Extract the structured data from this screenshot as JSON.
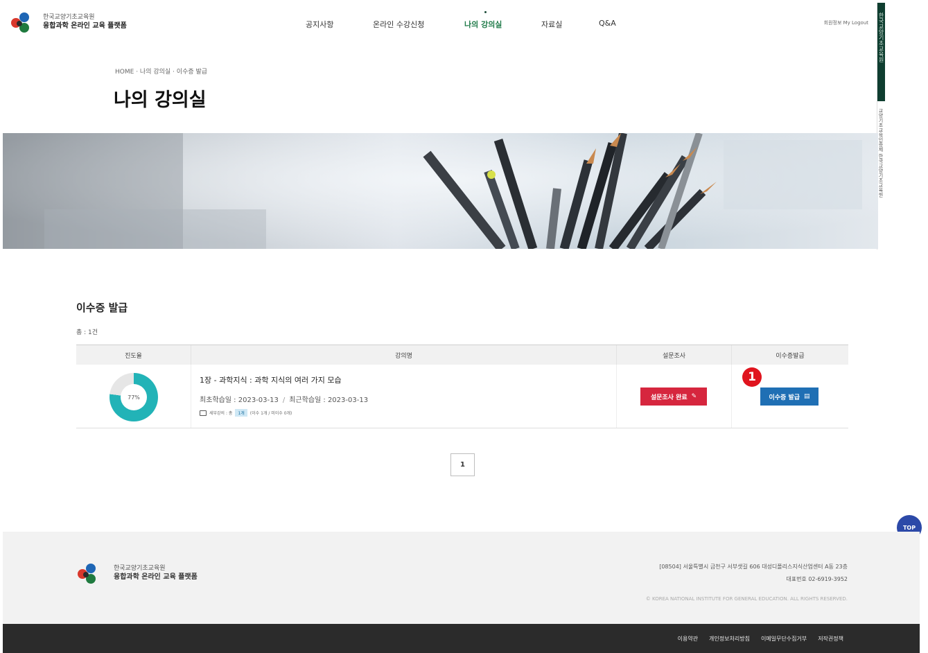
{
  "header": {
    "brand_line1": "한국교양기초교육원",
    "brand_line2": "융합과학 온라인 교육 플랫폼",
    "nav": [
      "공지사항",
      "온라인 수강신청",
      "나의 강의실",
      "자료실",
      "Q&A"
    ],
    "active_nav": "나의 강의실",
    "util": "회원정보  My  Logout"
  },
  "rail": {
    "primary": "한국교양기초교육원",
    "secondary": "교양기초교육인증제 한국교양기초교육원"
  },
  "breadcrumb": [
    "HOME",
    "나의 강의실",
    "이수증 발급"
  ],
  "page_title": "나의 강의실",
  "section": {
    "title": "이수증 발급",
    "total": "총 : 1건"
  },
  "table": {
    "headers": [
      "진도율",
      "강의명",
      "설문조사",
      "이수증발급"
    ],
    "rows": [
      {
        "progress_pct": 77,
        "progress_label": "77%",
        "course_title": "1장 - 과학지식 : 과학 지식의 여러 가지 모습",
        "first_study": "최초학습일 : 2023-03-13",
        "last_study": "최근학습일 : 2023-03-13",
        "meta_prefix": "세부강의 : 총",
        "meta_tag": "1개",
        "meta_suffix": "(이수 1개 / 미이수 0개)",
        "survey_button": "설문조사 완료",
        "cert_button": "이수증 발급"
      }
    ]
  },
  "marker": "1",
  "pagination": {
    "current": "1"
  },
  "top_button": "TOP",
  "footer": {
    "brand_line1": "한국교양기초교육원",
    "brand_line2": "융합과학 온라인 교육 플랫폼",
    "address": "[08504] 서울특별시 금천구 서부샛길 606 대성디폴리스지식산업센터 A동 23층",
    "phone": "대표번호 02-6919-3952",
    "copyright": "© KOREA NATIONAL INSTITUTE FOR GENERAL EDUCATION. ALL RIGHTS RESERVED.",
    "links": [
      "이용약관",
      "개인정보처리방침",
      "이메일무단수집거부",
      "저작권정책"
    ]
  },
  "colors": {
    "accent_green": "#1e7a48",
    "dark_green": "#0f3e30",
    "progress_teal": "#22b3b7",
    "survey_red": "#d6263e",
    "cert_blue": "#1f6fb4",
    "marker_red": "#e0141e",
    "top_blue": "#2c49a8"
  }
}
